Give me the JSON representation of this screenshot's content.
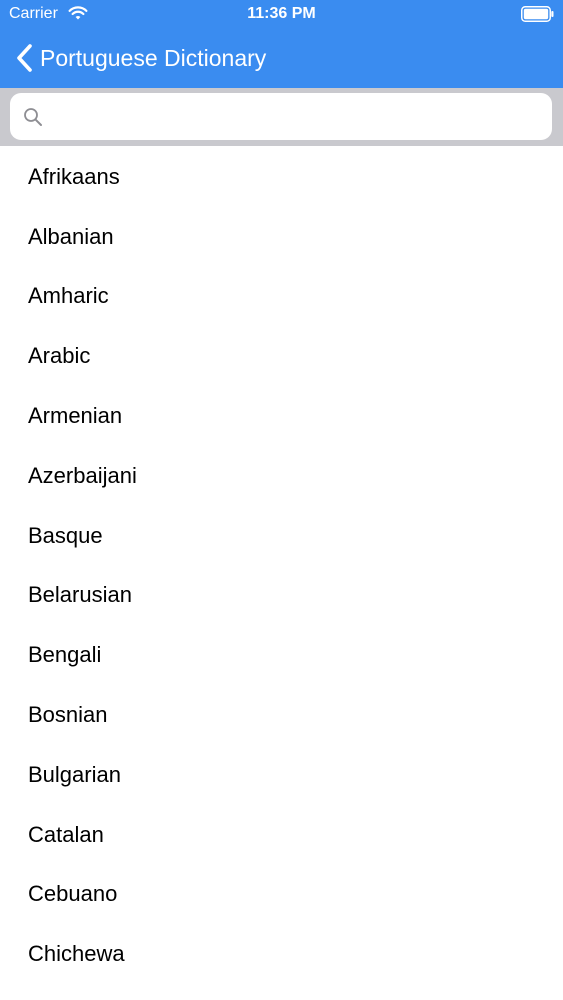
{
  "status_bar": {
    "carrier": "Carrier",
    "time": "11:36 PM",
    "wifi_icon": "wifi-icon",
    "battery_icon": "battery-icon"
  },
  "nav_bar": {
    "back_icon": "chevron-left-icon",
    "title": "Portuguese Dictionary",
    "background_color": "#3a8cf0",
    "text_color": "#ffffff"
  },
  "search": {
    "icon": "search-icon",
    "value": "",
    "placeholder": ""
  },
  "languages": [
    "Afrikaans",
    "Albanian",
    "Amharic",
    "Arabic",
    "Armenian",
    "Azerbaijani",
    "Basque",
    "Belarusian",
    "Bengali",
    "Bosnian",
    "Bulgarian",
    "Catalan",
    "Cebuano",
    "Chichewa"
  ]
}
